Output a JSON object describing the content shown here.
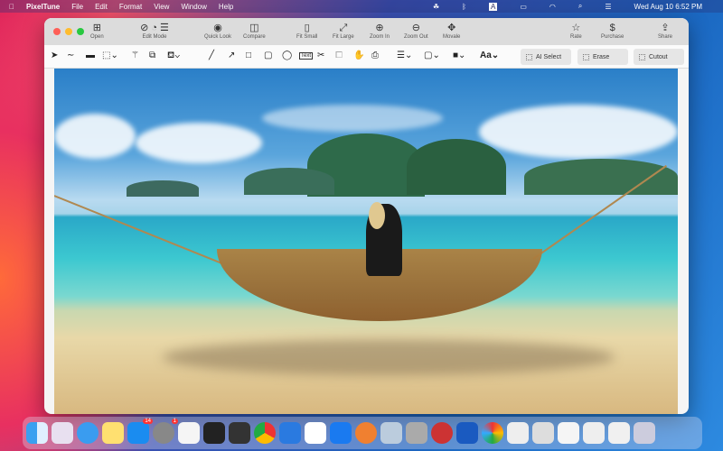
{
  "menubar": {
    "app": "PixelTune",
    "items": [
      "File",
      "Edit",
      "Format",
      "View",
      "Window",
      "Help"
    ],
    "datetime": "Wed Aug 10  6:52 PM"
  },
  "toolbar": {
    "open": "Open",
    "edit_mode": "Edit Mode",
    "quick_look": "Quick Look",
    "compare": "Compare",
    "fit_small": "Fit Small",
    "fit_large": "Fit Large",
    "zoom_in": "Zoom In",
    "zoom_out": "Zoom Out",
    "movable": "Movale",
    "rate": "Rate",
    "purchase": "Purchase",
    "share": "Share"
  },
  "tools": {
    "text_tool": "Text",
    "font": "Aa",
    "ai_select": "AI Select",
    "erase": "Erase",
    "cutout": "Cutout"
  },
  "dock": {
    "badges": {
      "appstore": "14",
      "settings": "1"
    }
  },
  "colors": {
    "red": "#fe5f57",
    "yellow": "#febc2e",
    "green": "#28c840"
  }
}
